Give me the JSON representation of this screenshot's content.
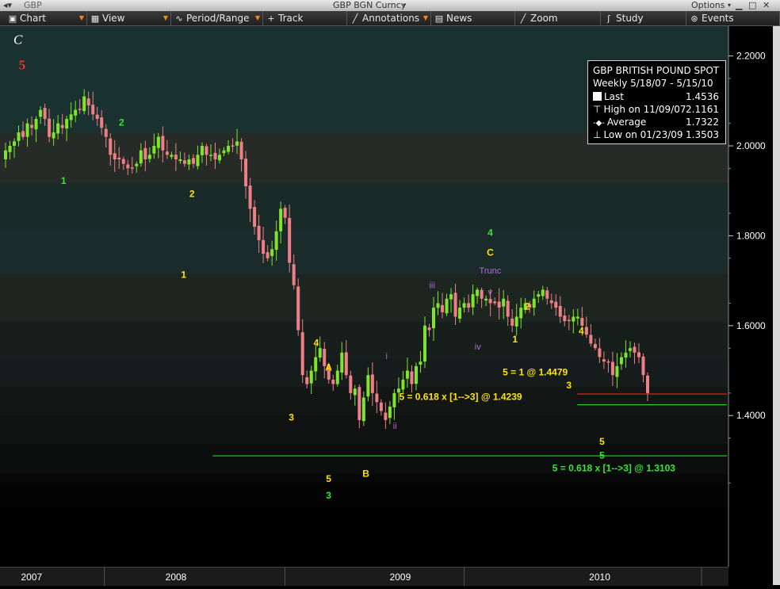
{
  "window": {
    "ticker": "GBP",
    "security": "GBP BGN Curncy",
    "options_label": "Options"
  },
  "menu": [
    {
      "label": "Chart",
      "icon": "chart-icon",
      "dropdown": true
    },
    {
      "label": "View",
      "icon": "view-icon",
      "dropdown": true
    },
    {
      "label": "Period/Range",
      "icon": "period-icon",
      "dropdown": true
    },
    {
      "label": "Track",
      "icon": "plus-icon",
      "dropdown": false
    },
    {
      "label": "Annotations",
      "icon": "pencil-icon",
      "dropdown": true
    },
    {
      "label": "News",
      "icon": "news-icon",
      "dropdown": false
    },
    {
      "label": "Zoom",
      "icon": "zoom-icon",
      "dropdown": false
    },
    {
      "label": "Study",
      "icon": "study-icon",
      "dropdown": false
    },
    {
      "label": "Events",
      "icon": "events-icon",
      "dropdown": false
    }
  ],
  "infobox": {
    "title": "GBP  BRITISH POUND SPOT",
    "range": "Weekly 5/18/07 - 5/15/10",
    "last_label": "Last",
    "last_value": "1.4536",
    "high_label": "High on 11/09/07",
    "high_value": "2.1161",
    "avg_label": "Average",
    "avg_value": "1.7322",
    "low_label": "Low on 01/23/09",
    "low_value": "1.3503"
  },
  "colors": {
    "up": "#7ee52a",
    "down": "#ef7f86",
    "yellow": "#ffe400",
    "green": "#33e833",
    "purple": "#b26fd2",
    "red": "#ff2a2a",
    "white": "#ffffff"
  },
  "chart_data": {
    "type": "candlestick",
    "title": "",
    "ylim": [
      1.2,
      2.3
    ],
    "yticks": [
      1.4,
      1.6,
      1.8,
      2.0,
      2.2
    ],
    "ytick_labels": [
      "1.4000",
      "1.6000",
      "1.8000",
      "2.0000",
      "2.2000"
    ],
    "xtick_labels": [
      "2007",
      "2008",
      "2009",
      "2010"
    ],
    "start_date": "2007-05-18",
    "end_date": "2010-05-15",
    "closes": [
      1.99,
      2.0,
      2.01,
      2.03,
      2.02,
      2.05,
      2.04,
      2.06,
      2.08,
      2.06,
      2.02,
      2.03,
      2.05,
      2.04,
      2.06,
      2.07,
      2.08,
      2.08,
      2.11,
      2.09,
      2.07,
      2.06,
      2.04,
      2.02,
      1.98,
      1.97,
      1.97,
      1.96,
      1.95,
      1.95,
      1.96,
      1.99,
      1.97,
      1.98,
      2.0,
      2.02,
      1.99,
      1.98,
      1.98,
      1.97,
      1.97,
      1.96,
      1.97,
      1.96,
      1.98,
      2.0,
      1.98,
      1.98,
      1.97,
      1.98,
      1.99,
      2.0,
      2.0,
      2.01,
      1.97,
      1.91,
      1.86,
      1.82,
      1.79,
      1.76,
      1.75,
      1.77,
      1.81,
      1.86,
      1.84,
      1.74,
      1.69,
      1.59,
      1.49,
      1.47,
      1.5,
      1.53,
      1.55,
      1.51,
      1.48,
      1.47,
      1.5,
      1.54,
      1.49,
      1.45,
      1.46,
      1.39,
      1.44,
      1.49,
      1.45,
      1.43,
      1.41,
      1.39,
      1.42,
      1.45,
      1.46,
      1.48,
      1.5,
      1.47,
      1.51,
      1.52,
      1.6,
      1.59,
      1.64,
      1.65,
      1.63,
      1.66,
      1.67,
      1.62,
      1.64,
      1.65,
      1.64,
      1.67,
      1.68,
      1.66,
      1.66,
      1.65,
      1.65,
      1.64,
      1.66,
      1.62,
      1.6,
      1.62,
      1.64,
      1.65,
      1.64,
      1.66,
      1.67,
      1.68,
      1.66,
      1.65,
      1.64,
      1.62,
      1.61,
      1.61,
      1.62,
      1.62,
      1.6,
      1.58,
      1.56,
      1.55,
      1.53,
      1.52,
      1.52,
      1.49,
      1.51,
      1.53,
      1.54,
      1.55,
      1.54,
      1.53,
      1.49,
      1.45
    ],
    "annotations": [
      {
        "text": "C",
        "color": "white",
        "date": "2007-06-08",
        "y": 2.227,
        "style": "italic-serif"
      },
      {
        "text": "5",
        "color": "red",
        "date": "2007-06-15",
        "y": 2.17,
        "style": "bold-serif"
      },
      {
        "text": "2",
        "color": "green",
        "date": "2007-11-30",
        "y": 2.045
      },
      {
        "text": "1",
        "color": "green",
        "date": "2007-08-24",
        "y": 1.915
      },
      {
        "text": "2",
        "color": "yellow",
        "date": "2008-03-28",
        "y": 1.886
      },
      {
        "text": "1",
        "color": "yellow",
        "date": "2008-03-14",
        "y": 1.706
      },
      {
        "text": "4",
        "color": "yellow",
        "date": "2008-10-24",
        "y": 1.555
      },
      {
        "text": "A",
        "color": "yellow",
        "date": "2008-11-14",
        "y": 1.5
      },
      {
        "text": "3",
        "color": "yellow",
        "date": "2008-09-12",
        "y": 1.389
      },
      {
        "text": "5",
        "color": "yellow",
        "date": "2008-11-14",
        "y": 1.252
      },
      {
        "text": "B",
        "color": "yellow",
        "date": "2009-01-16",
        "y": 1.264
      },
      {
        "text": "3",
        "color": "green",
        "date": "2008-11-14",
        "y": 1.215
      },
      {
        "text": "i",
        "color": "purple",
        "date": "2009-02-20",
        "y": 1.526
      },
      {
        "text": "ii",
        "color": "purple",
        "date": "2009-03-06",
        "y": 1.37
      },
      {
        "text": "iii",
        "color": "purple",
        "date": "2009-05-08",
        "y": 1.683
      },
      {
        "text": "iv",
        "color": "purple",
        "date": "2009-07-24",
        "y": 1.547
      },
      {
        "text": "v",
        "color": "purple",
        "date": "2009-08-14",
        "y": 1.668
      },
      {
        "text": "Trunc",
        "color": "purple",
        "date": "2009-08-14",
        "y": 1.716
      },
      {
        "text": "C",
        "color": "yellow",
        "date": "2009-08-14",
        "y": 1.756
      },
      {
        "text": "4",
        "color": "green",
        "date": "2009-08-14",
        "y": 1.8
      },
      {
        "text": "2",
        "color": "yellow",
        "date": "2009-10-16",
        "y": 1.636
      },
      {
        "text": "1",
        "color": "yellow",
        "date": "2009-09-25",
        "y": 1.563
      },
      {
        "text": "4",
        "color": "yellow",
        "date": "2010-01-15",
        "y": 1.581
      },
      {
        "text": "3",
        "color": "yellow",
        "date": "2009-12-25",
        "y": 1.46
      },
      {
        "text": "5",
        "color": "yellow",
        "date": "2010-02-19",
        "y": 1.335
      },
      {
        "text": "5",
        "color": "green",
        "date": "2010-02-19",
        "y": 1.304
      },
      {
        "text": "5 = 1 @ 1.4479",
        "color": "yellow",
        "date": "2009-09-04",
        "y": 1.489,
        "anchor": "start"
      },
      {
        "text": "5 = 0.618 x [1-->3] @ 1.4239",
        "color": "yellow",
        "date": "2009-03-13",
        "y": 1.435,
        "anchor": "start"
      },
      {
        "text": "5 = 0.618 x [1-->3] @ 1.3103",
        "color": "green",
        "date": "2009-11-27",
        "y": 1.276,
        "anchor": "start"
      }
    ],
    "hlines": [
      {
        "y": 1.4479,
        "color": "red",
        "from": "2010-01-08",
        "to": "2010-05-15"
      },
      {
        "y": 1.4239,
        "color": "green",
        "from": "2010-01-08",
        "to": "2010-05-15"
      },
      {
        "y": 1.3103,
        "color": "green",
        "from": "2008-05-02",
        "to": "2010-05-15"
      }
    ]
  }
}
